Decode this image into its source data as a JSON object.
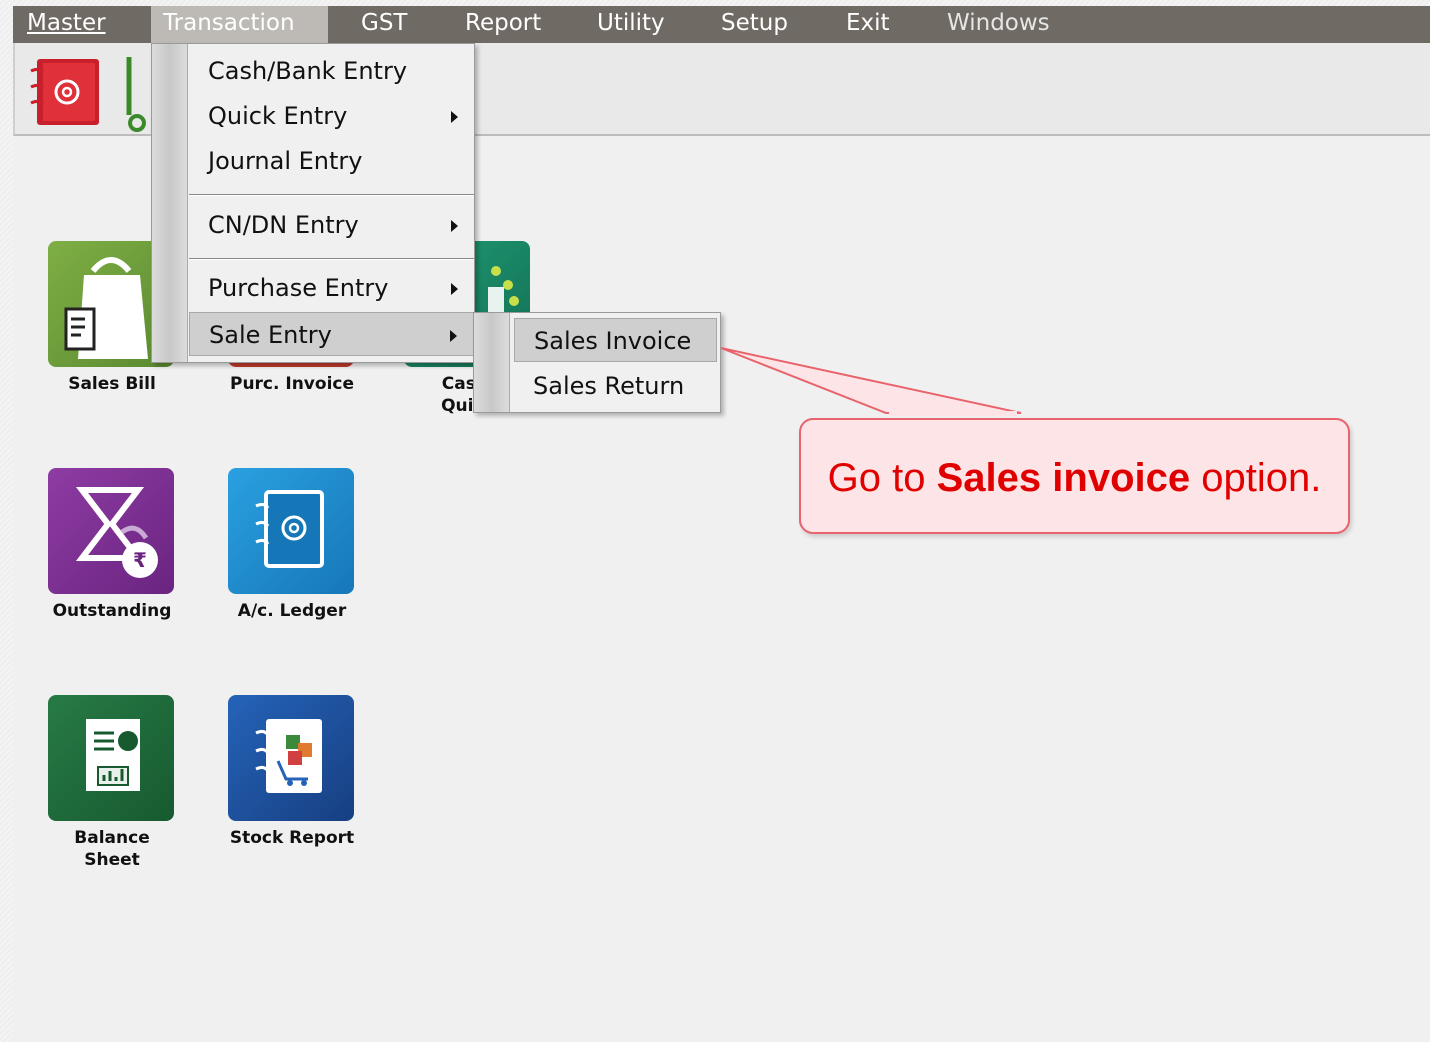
{
  "menubar": {
    "items": [
      {
        "label": "Master"
      },
      {
        "label": "Transaction"
      },
      {
        "label": "GST"
      },
      {
        "label": "Report"
      },
      {
        "label": "Utility"
      },
      {
        "label": "Setup"
      },
      {
        "label": "Exit"
      },
      {
        "label": "Windows"
      }
    ]
  },
  "transaction_menu": {
    "items": [
      {
        "label": "Cash/Bank Entry"
      },
      {
        "label": "Quick Entry"
      },
      {
        "label": "Journal Entry"
      },
      {
        "label": "CN/DN Entry"
      },
      {
        "label": "Purchase Entry"
      },
      {
        "label": "Sale Entry"
      }
    ]
  },
  "sale_entry_submenu": {
    "items": [
      {
        "label": "Sales Invoice"
      },
      {
        "label": "Sales Return"
      }
    ]
  },
  "tiles": [
    {
      "label": "Sales Bill",
      "color": "#6a9a3a"
    },
    {
      "label": "Purc. Invoice",
      "color": "#c0392b"
    },
    {
      "label_line1": "Cash/",
      "label_line2": "Quick",
      "color": "#1a8a6a"
    },
    {
      "label": "Outstanding",
      "color": "#7b2d8e"
    },
    {
      "label": "A/c. Ledger",
      "color": "#1e8fd0"
    },
    {
      "label_line1": "Balance",
      "label_line2": "Sheet",
      "color": "#1e6b3a"
    },
    {
      "label": "Stock Report",
      "color": "#1f4f9e"
    }
  ],
  "callout": {
    "prefix": "Go to ",
    "bold": "Sales invoice",
    "suffix": " option."
  },
  "colors": {
    "menubar": "#6f6a63",
    "callout_fill": "#fde4e6",
    "callout_border": "#e8636b",
    "callout_text": "#e00000"
  }
}
